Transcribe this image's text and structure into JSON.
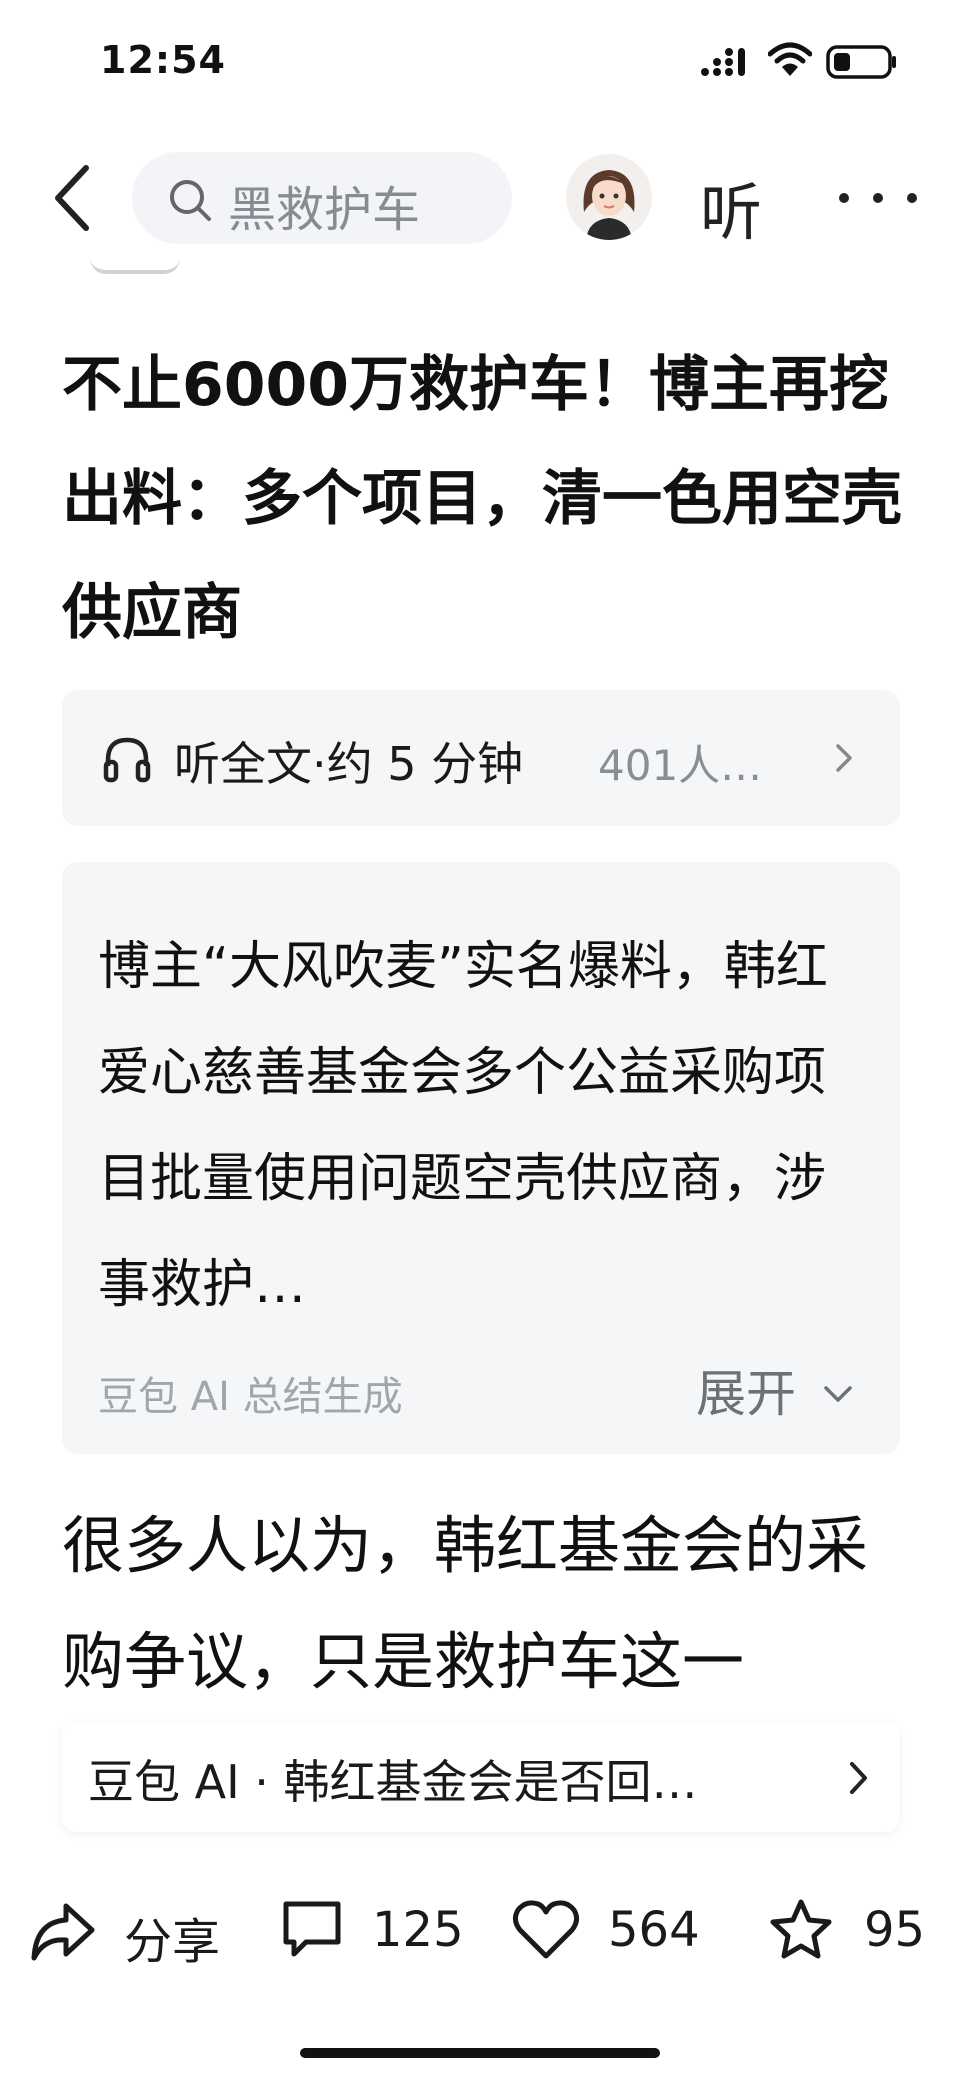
{
  "status_bar": {
    "time": "12:54",
    "icons": [
      "signal-icon",
      "wifi-icon",
      "battery-icon"
    ]
  },
  "nav": {
    "back_icon": "chevron-left-icon",
    "search_icon": "search-icon",
    "search_text": "黑救护车",
    "listen_label": "听",
    "more_icon": "more-icon"
  },
  "article": {
    "title": "不止6000万救护车！博主再挖出料：多个项目，清一色用空壳供应商"
  },
  "listen_card": {
    "icon": "headphone-icon",
    "label": "听全文·约 5 分钟",
    "count": "401人…"
  },
  "summary": {
    "text": "博主“大风吹麦”实名爆料，韩红爱心慈善基金会多个公益采购项目批量使用问题空壳供应商，涉事救护…",
    "source": "豆包 AI 总结生成",
    "expand_label": "展开"
  },
  "body": {
    "text": "很多人以为，韩红基金会的采购争议，只是救护车这一"
  },
  "ai_question": {
    "text": "豆包 AI · 韩红基金会是否回…"
  },
  "actions": {
    "share_label": "分享",
    "comment_count": "125",
    "like_count": "564",
    "favorite_count": "95"
  },
  "colors": {
    "card_bg": "#f5f6f8",
    "search_bg": "#f2f4f7",
    "muted_text": "#8a8d94",
    "primary_text": "#111111"
  }
}
